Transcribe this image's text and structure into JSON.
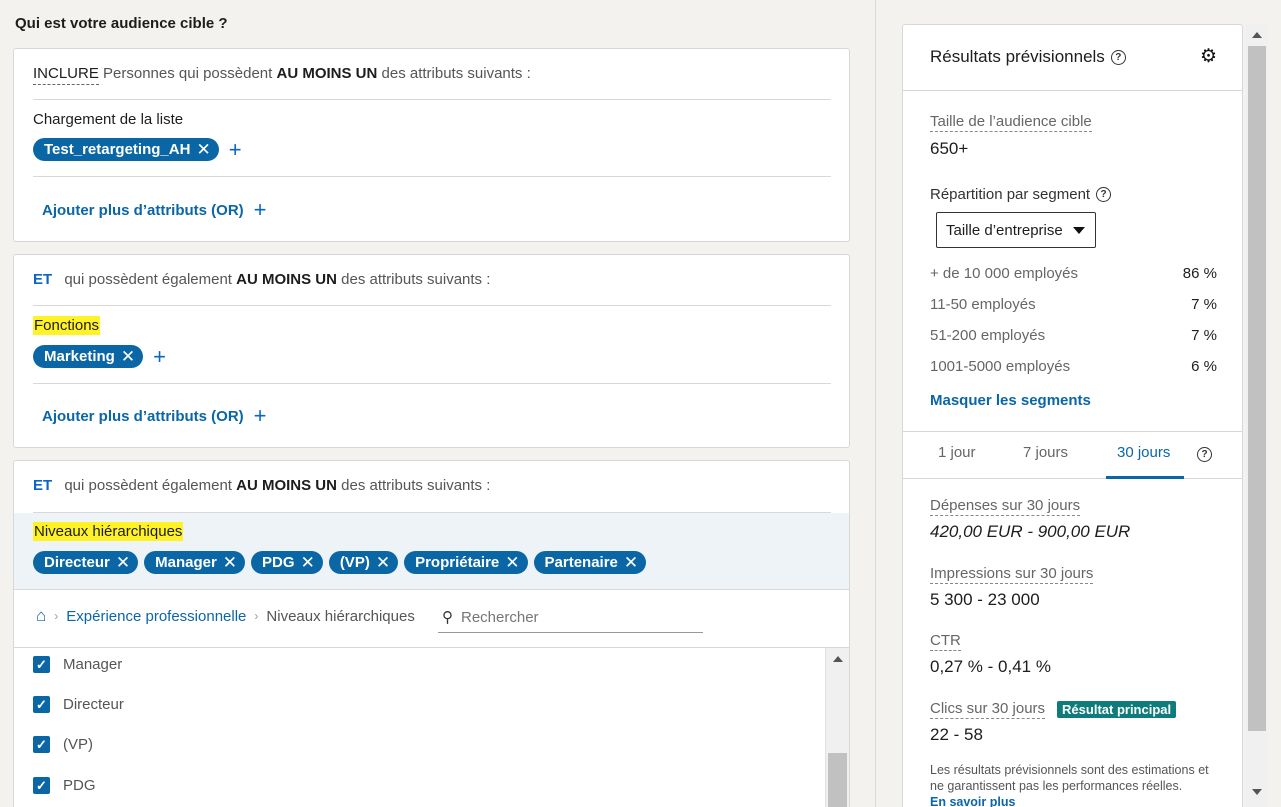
{
  "page": {
    "question": "Qui est votre audience cible ?"
  },
  "include_card": {
    "keyword": "INCLURE",
    "pre": "Personnes qui possèdent",
    "bold": "AU MOINS UN",
    "post": "des attributs suivants :",
    "section_label": "Chargement de la liste",
    "chips": [
      "Test_retargeting_AH"
    ],
    "add_more": "Ajouter plus d’attributs (OR)"
  },
  "and_card_1": {
    "keyword": "ET",
    "pre": "qui possèdent également",
    "bold": "AU MOINS UN",
    "post": "des attributs suivants :",
    "section_label": "Fonctions",
    "chips": [
      "Marketing"
    ],
    "add_more": "Ajouter plus d’attributs (OR)"
  },
  "and_card_2": {
    "keyword": "ET",
    "pre": "qui possèdent également",
    "bold": "AU MOINS UN",
    "post": "des attributs suivants :",
    "section_label": "Niveaux hiérarchiques",
    "chips": [
      "Directeur",
      "Manager",
      "PDG",
      "(VP)",
      "Propriétaire",
      "Partenaire"
    ],
    "breadcrumb": {
      "link": "Expérience professionnelle",
      "current": "Niveaux hiérarchiques"
    },
    "search_placeholder": "Rechercher",
    "options": [
      {
        "label": "Manager",
        "checked": true
      },
      {
        "label": "Directeur",
        "checked": true
      },
      {
        "label": "(VP)",
        "checked": true
      },
      {
        "label": "PDG",
        "checked": true
      }
    ]
  },
  "forecast": {
    "title": "Résultats prévisionnels",
    "audience_label": "Taille de l’audience cible",
    "audience_value": "650+",
    "segment_title": "Répartition par segment",
    "segment_select": "Taille d’entreprise",
    "segments": [
      {
        "label": "+ de 10 000 employés",
        "pct": "86 %"
      },
      {
        "label": "11-50 employés",
        "pct": "7 %"
      },
      {
        "label": "51-200 employés",
        "pct": "7 %"
      },
      {
        "label": "1001-5000 employés",
        "pct": "6 %"
      }
    ],
    "hide_segments": "Masquer les segments",
    "tabs": [
      "1 jour",
      "7 jours",
      "30 jours"
    ],
    "active_tab": "30 jours",
    "spend_label": "Dépenses sur 30 jours",
    "spend_value": "420,00 EUR - 900,00 EUR",
    "impr_label": "Impressions sur 30 jours",
    "impr_value": "5 300 - 23 000",
    "ctr_label": "CTR",
    "ctr_value": "0,27 % - 0,41 %",
    "clicks_label": "Clics sur 30 jours",
    "clicks_badge": "Résultat principal",
    "clicks_value": "22 - 58",
    "disclaimer": "Les résultats prévisionnels sont des estimations et ne garantissent pas les performances réelles.",
    "learn_more": "En savoir plus"
  },
  "colors": {
    "accent": "#0b66a6",
    "highlight": "#fff227",
    "badge": "#0f7b7b"
  }
}
